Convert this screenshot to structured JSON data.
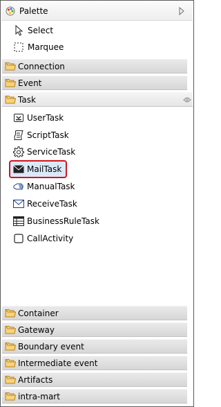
{
  "palette": {
    "title": "Palette",
    "tools": [
      {
        "label": "Select",
        "icon": "select-arrow-icon"
      },
      {
        "label": "Marquee",
        "icon": "marquee-icon"
      }
    ],
    "drawers_top": [
      {
        "label": "Connection"
      },
      {
        "label": "Event"
      }
    ],
    "task_drawer": {
      "label": "Task",
      "entries": [
        {
          "label": "UserTask",
          "icon": "user-task-icon"
        },
        {
          "label": "ScriptTask",
          "icon": "script-task-icon"
        },
        {
          "label": "ServiceTask",
          "icon": "gear-icon"
        },
        {
          "label": "MailTask",
          "icon": "mail-icon",
          "selected": true
        },
        {
          "label": "ManualTask",
          "icon": "hand-icon"
        },
        {
          "label": "ReceiveTask",
          "icon": "envelope-outline-icon"
        },
        {
          "label": "BusinessRuleTask",
          "icon": "table-icon"
        },
        {
          "label": "CallActivity",
          "icon": "call-activity-icon"
        }
      ]
    },
    "drawers_bottom": [
      {
        "label": "Container"
      },
      {
        "label": "Gateway"
      },
      {
        "label": "Boundary event"
      },
      {
        "label": "Intermediate event"
      },
      {
        "label": "Artifacts"
      },
      {
        "label": "intra-mart"
      }
    ],
    "colors": {
      "selection_fill": "#dbe8f9",
      "selection_border": "#d0161e",
      "folder": "#f2b84b"
    }
  }
}
